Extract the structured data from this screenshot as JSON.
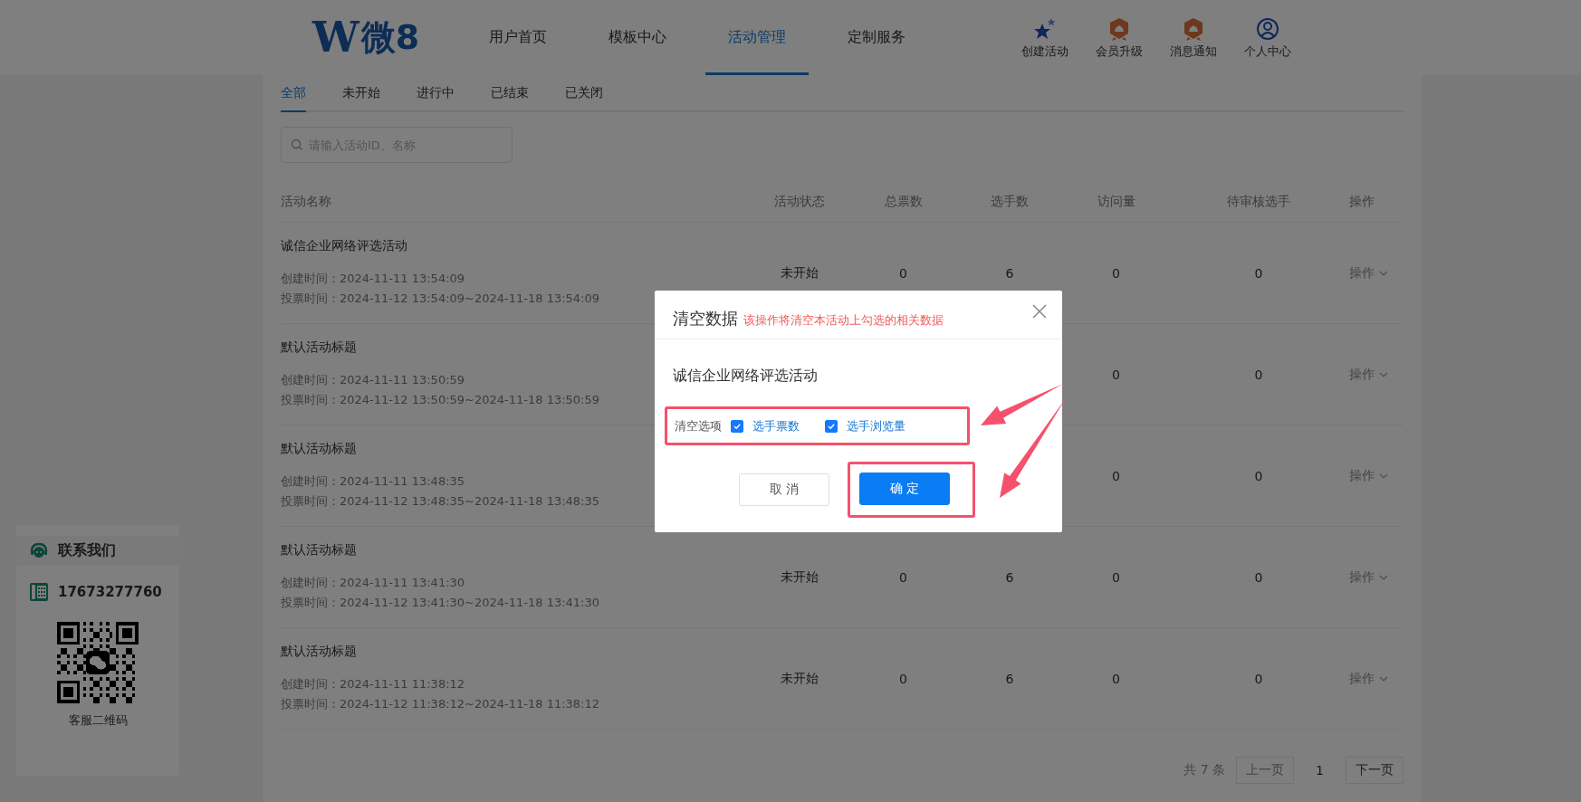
{
  "header": {
    "logo": {
      "mark": "W",
      "text": "微8"
    },
    "nav": [
      {
        "label": "用户首页",
        "selected": false
      },
      {
        "label": "模板中心",
        "selected": false
      },
      {
        "label": "活动管理",
        "selected": true
      },
      {
        "label": "定制服务",
        "selected": false
      }
    ],
    "actions": [
      {
        "kind": "stars",
        "label": "创建活动"
      },
      {
        "kind": "badge",
        "label": "会员升级"
      },
      {
        "kind": "badge",
        "label": "消息通知"
      },
      {
        "kind": "user",
        "label": "个人中心"
      }
    ]
  },
  "tabs": [
    {
      "label": "全部",
      "selected": true
    },
    {
      "label": "未开始",
      "selected": false
    },
    {
      "label": "进行中",
      "selected": false
    },
    {
      "label": "已结束",
      "selected": false
    },
    {
      "label": "已关闭",
      "selected": false
    }
  ],
  "search": {
    "placeholder": "请输入活动ID、名称"
  },
  "table": {
    "columns": [
      "活动名称",
      "活动状态",
      "总票数",
      "选手数",
      "访问量",
      "待审核选手",
      "操作"
    ],
    "rows": [
      {
        "name": "诚信企业网络评选活动",
        "created": "创建时间：2024-11-11 13:54:09",
        "voting": "投票时间：2024-11-12 13:54:09~2024-11-18 13:54:09",
        "status": "未开始",
        "total_votes": "0",
        "players": "6",
        "visits": "0",
        "pending": "0",
        "action": "操作"
      },
      {
        "name": "默认活动标题",
        "created": "创建时间：2024-11-11 13:50:59",
        "voting": "投票时间：2024-11-12 13:50:59~2024-11-18 13:50:59",
        "visits": "0",
        "pending": "0",
        "action": "操作"
      },
      {
        "name": "默认活动标题",
        "created": "创建时间：2024-11-11 13:48:35",
        "voting": "投票时间：2024-11-12 13:48:35~2024-11-18 13:48:35",
        "visits": "0",
        "pending": "0",
        "action": "操作"
      },
      {
        "name": "默认活动标题",
        "created": "创建时间：2024-11-11 13:41:30",
        "voting": "投票时间：2024-11-12 13:41:30~2024-11-18 13:41:30",
        "status": "未开始",
        "total_votes": "0",
        "players": "6",
        "visits": "0",
        "pending": "0",
        "action": "操作"
      },
      {
        "name": "默认活动标题",
        "created": "创建时间：2024-11-11 11:38:12",
        "voting": "投票时间：2024-11-12 11:38:12~2024-11-18 11:38:12",
        "status": "未开始",
        "total_votes": "0",
        "players": "6",
        "visits": "0",
        "pending": "0",
        "action": "操作"
      }
    ]
  },
  "pagination": {
    "total": "共 7 条",
    "prev": "上一页",
    "page": "1",
    "next": "下一页"
  },
  "contact": {
    "title": "联系我们",
    "phone": "17673277760",
    "qr_caption": "客服二维码"
  },
  "dialog": {
    "title": "清空数据",
    "warning": "该操作将清空本活动上勾选的相关数据",
    "activity": "诚信企业网络评选活动",
    "options_label": "清空选项",
    "options": [
      {
        "label": "选手票数",
        "checked": true
      },
      {
        "label": "选手浏览量",
        "checked": true
      }
    ],
    "buttons": [
      {
        "label": "取 消",
        "kind": "default"
      },
      {
        "label": "确 定",
        "kind": "primary"
      }
    ]
  }
}
